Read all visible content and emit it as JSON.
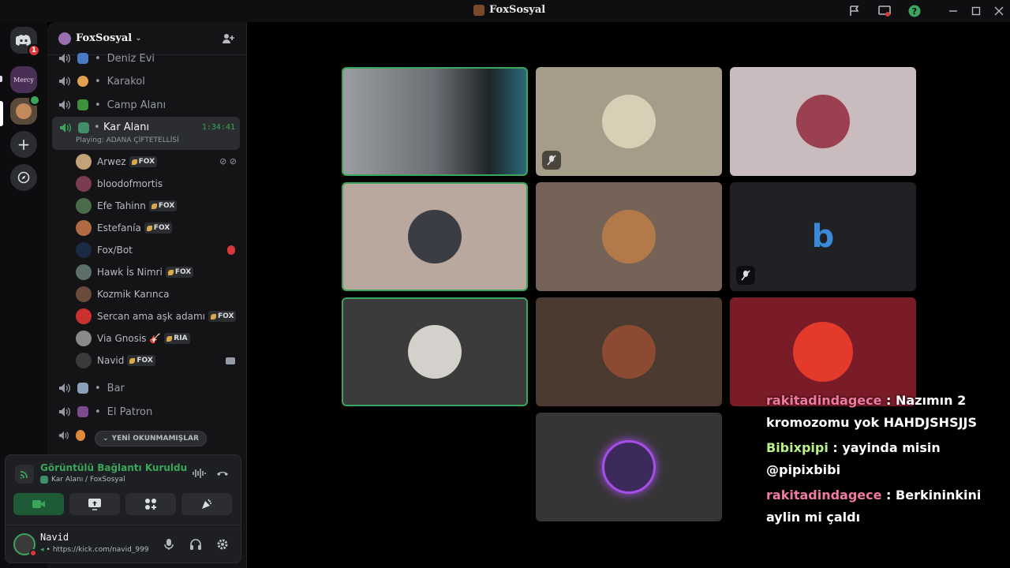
{
  "window": {
    "title": "FoxSosyal"
  },
  "servers": {
    "home_badge": "1",
    "server1_label": "Mercy"
  },
  "guild": {
    "name": "FoxSosyal"
  },
  "channels": [
    {
      "name": "Deniz Evi"
    },
    {
      "name": "Karakol"
    },
    {
      "name": "Camp Alanı"
    },
    {
      "name": "Kar Alanı",
      "timer": "1:34:41",
      "status": "Playing: ADANA ÇİFTETELLİSİ"
    },
    {
      "name": "Bar"
    },
    {
      "name": "El Patron"
    }
  ],
  "members": [
    {
      "name": "Arwez",
      "tag": "FOX",
      "color": "#c4a277"
    },
    {
      "name": "bloodofmortis",
      "tag": "",
      "color": "#7a3c4e"
    },
    {
      "name": "Efe Tahinn",
      "tag": "FOX",
      "color": "#4b6b4b"
    },
    {
      "name": "Estefanía",
      "tag": "FOX",
      "color": "#b06b45"
    },
    {
      "name": "Fox/Bot",
      "tag": "",
      "color": "#1a2a44"
    },
    {
      "name": "Hawk İs Nimri",
      "tag": "FOX",
      "color": "#5a6f6a"
    },
    {
      "name": "Kozmik Karınca",
      "tag": "",
      "color": "#6a4a3a"
    },
    {
      "name": "Sercan ama aşk adamı",
      "tag": "FOX",
      "color": "#c9312f"
    },
    {
      "name": "Via Gnosis 🎸",
      "tag": "RIA",
      "color": "#8a8a8a"
    },
    {
      "name": "Navid",
      "tag": "FOX",
      "color": "#3a3a3a"
    }
  ],
  "unread_pill": "YENİ OKUNMAMIŞLAR",
  "voice": {
    "status": "Görüntülü Bağlantı Kuruldu",
    "location": "Kar Alanı / FoxSosyal"
  },
  "user": {
    "name": "Navid",
    "status": "https://kick.com/navid_999"
  },
  "tiles": [
    {
      "bg": "#8f9296",
      "pfp": "#2b2f36",
      "speaking": true,
      "muted": false
    },
    {
      "bg": "#a59c8a",
      "pfp": "#d8cfb6",
      "speaking": false,
      "muted": true
    },
    {
      "bg": "#c9bbbe",
      "pfp": "#9a4050",
      "speaking": false,
      "muted": false
    },
    {
      "bg": "#b8a89d",
      "pfp": "#3a3d44",
      "speaking": true,
      "muted": false
    },
    {
      "bg": "#746356",
      "pfp": "#b27a4a",
      "speaking": false,
      "muted": false
    },
    {
      "bg": "#1f2124",
      "pfp": "#1f2124",
      "speaking": false,
      "muted": true
    },
    {
      "bg": "#3b3b3b",
      "pfp": "#d4d0cc",
      "speaking": true,
      "muted": false
    },
    {
      "bg": "#4a3a30",
      "pfp": "#8c4a33",
      "speaking": false,
      "muted": false
    },
    {
      "bg": "#7a1c28",
      "pfp": "#e33a2c",
      "speaking": false,
      "muted": false
    },
    {
      "bg": "#353535",
      "pfp": "#3b2a5a",
      "speaking": false,
      "muted": false
    }
  ],
  "chat": [
    {
      "user": "rakitadindagece",
      "text": " : Nazımın 2 kromozomu yok HAHDJSHSJJS",
      "style": "u1"
    },
    {
      "user": "Bibixpipi",
      "text": " : yayinda misin @pipixbibi",
      "style": "u2"
    },
    {
      "user": "rakitadindagece",
      "text": " : Berkininkini aylin mi çaldı",
      "style": "u1"
    }
  ]
}
